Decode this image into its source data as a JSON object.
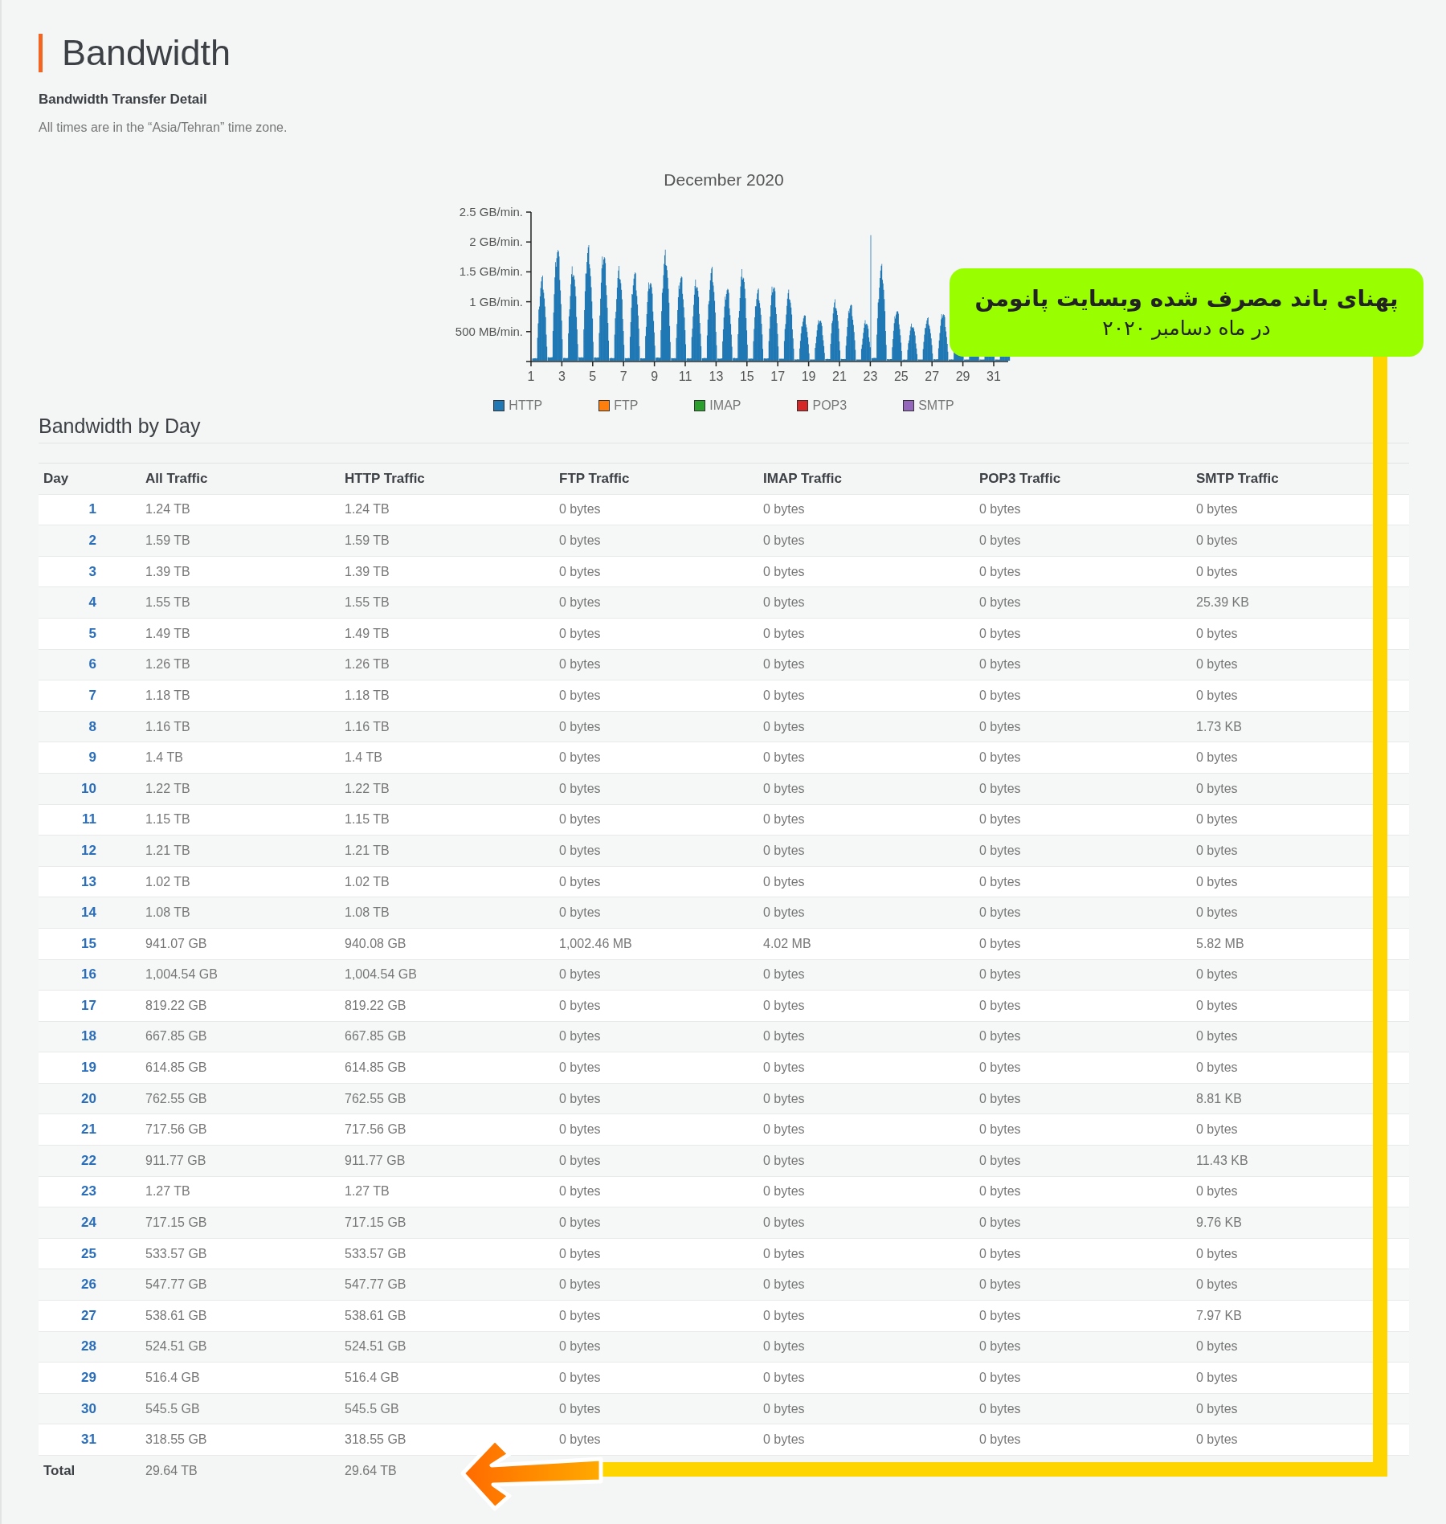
{
  "page": {
    "title": "Bandwidth",
    "subtitle": "Bandwidth Transfer Detail",
    "note": "All times are in the “Asia/Tehran” time zone."
  },
  "chart": {
    "title": "December 2020",
    "y_ticks": [
      "2.5 GB/min.",
      "2 GB/min.",
      "1.5 GB/min.",
      "1 GB/min.",
      "500 MB/min."
    ],
    "x_ticks": [
      "1",
      "3",
      "5",
      "7",
      "9",
      "11",
      "13",
      "15",
      "17",
      "19",
      "21",
      "23",
      "25",
      "27",
      "29",
      "31"
    ],
    "legend": [
      {
        "label": "HTTP",
        "color": "#1f77b4"
      },
      {
        "label": "FTP",
        "color": "#ff7f0e"
      },
      {
        "label": "IMAP",
        "color": "#2ca02c"
      },
      {
        "label": "POP3",
        "color": "#d62728"
      },
      {
        "label": "SMTP",
        "color": "#9467bd"
      }
    ]
  },
  "section_title": "Bandwidth by Day",
  "table": {
    "columns": [
      "Day",
      "All Traffic",
      "HTTP Traffic",
      "FTP Traffic",
      "IMAP Traffic",
      "POP3 Traffic",
      "SMTP Traffic"
    ],
    "rows": [
      [
        "1",
        "1.24 TB",
        "1.24 TB",
        "0 bytes",
        "0 bytes",
        "0 bytes",
        "0 bytes"
      ],
      [
        "2",
        "1.59 TB",
        "1.59 TB",
        "0 bytes",
        "0 bytes",
        "0 bytes",
        "0 bytes"
      ],
      [
        "3",
        "1.39 TB",
        "1.39 TB",
        "0 bytes",
        "0 bytes",
        "0 bytes",
        "0 bytes"
      ],
      [
        "4",
        "1.55 TB",
        "1.55 TB",
        "0 bytes",
        "0 bytes",
        "0 bytes",
        "25.39 KB"
      ],
      [
        "5",
        "1.49 TB",
        "1.49 TB",
        "0 bytes",
        "0 bytes",
        "0 bytes",
        "0 bytes"
      ],
      [
        "6",
        "1.26 TB",
        "1.26 TB",
        "0 bytes",
        "0 bytes",
        "0 bytes",
        "0 bytes"
      ],
      [
        "7",
        "1.18 TB",
        "1.18 TB",
        "0 bytes",
        "0 bytes",
        "0 bytes",
        "0 bytes"
      ],
      [
        "8",
        "1.16 TB",
        "1.16 TB",
        "0 bytes",
        "0 bytes",
        "0 bytes",
        "1.73 KB"
      ],
      [
        "9",
        "1.4 TB",
        "1.4 TB",
        "0 bytes",
        "0 bytes",
        "0 bytes",
        "0 bytes"
      ],
      [
        "10",
        "1.22 TB",
        "1.22 TB",
        "0 bytes",
        "0 bytes",
        "0 bytes",
        "0 bytes"
      ],
      [
        "11",
        "1.15 TB",
        "1.15 TB",
        "0 bytes",
        "0 bytes",
        "0 bytes",
        "0 bytes"
      ],
      [
        "12",
        "1.21 TB",
        "1.21 TB",
        "0 bytes",
        "0 bytes",
        "0 bytes",
        "0 bytes"
      ],
      [
        "13",
        "1.02 TB",
        "1.02 TB",
        "0 bytes",
        "0 bytes",
        "0 bytes",
        "0 bytes"
      ],
      [
        "14",
        "1.08 TB",
        "1.08 TB",
        "0 bytes",
        "0 bytes",
        "0 bytes",
        "0 bytes"
      ],
      [
        "15",
        "941.07 GB",
        "940.08 GB",
        "1,002.46 MB",
        "4.02 MB",
        "0 bytes",
        "5.82 MB"
      ],
      [
        "16",
        "1,004.54 GB",
        "1,004.54 GB",
        "0 bytes",
        "0 bytes",
        "0 bytes",
        "0 bytes"
      ],
      [
        "17",
        "819.22 GB",
        "819.22 GB",
        "0 bytes",
        "0 bytes",
        "0 bytes",
        "0 bytes"
      ],
      [
        "18",
        "667.85 GB",
        "667.85 GB",
        "0 bytes",
        "0 bytes",
        "0 bytes",
        "0 bytes"
      ],
      [
        "19",
        "614.85 GB",
        "614.85 GB",
        "0 bytes",
        "0 bytes",
        "0 bytes",
        "0 bytes"
      ],
      [
        "20",
        "762.55 GB",
        "762.55 GB",
        "0 bytes",
        "0 bytes",
        "0 bytes",
        "8.81 KB"
      ],
      [
        "21",
        "717.56 GB",
        "717.56 GB",
        "0 bytes",
        "0 bytes",
        "0 bytes",
        "0 bytes"
      ],
      [
        "22",
        "911.77 GB",
        "911.77 GB",
        "0 bytes",
        "0 bytes",
        "0 bytes",
        "11.43 KB"
      ],
      [
        "23",
        "1.27 TB",
        "1.27 TB",
        "0 bytes",
        "0 bytes",
        "0 bytes",
        "0 bytes"
      ],
      [
        "24",
        "717.15 GB",
        "717.15 GB",
        "0 bytes",
        "0 bytes",
        "0 bytes",
        "9.76 KB"
      ],
      [
        "25",
        "533.57 GB",
        "533.57 GB",
        "0 bytes",
        "0 bytes",
        "0 bytes",
        "0 bytes"
      ],
      [
        "26",
        "547.77 GB",
        "547.77 GB",
        "0 bytes",
        "0 bytes",
        "0 bytes",
        "0 bytes"
      ],
      [
        "27",
        "538.61 GB",
        "538.61 GB",
        "0 bytes",
        "0 bytes",
        "0 bytes",
        "7.97 KB"
      ],
      [
        "28",
        "524.51 GB",
        "524.51 GB",
        "0 bytes",
        "0 bytes",
        "0 bytes",
        "0 bytes"
      ],
      [
        "29",
        "516.4 GB",
        "516.4 GB",
        "0 bytes",
        "0 bytes",
        "0 bytes",
        "0 bytes"
      ],
      [
        "30",
        "545.5 GB",
        "545.5 GB",
        "0 bytes",
        "0 bytes",
        "0 bytes",
        "0 bytes"
      ],
      [
        "31",
        "318.55 GB",
        "318.55 GB",
        "0 bytes",
        "0 bytes",
        "0 bytes",
        "0 bytes"
      ]
    ],
    "total": {
      "label": "Total",
      "cells": [
        "29.64 TB",
        "29.64 TB"
      ]
    }
  },
  "annotation": {
    "title": "پهنای باند مصرف شده وبسایت پانومن",
    "subtitle": "در ماه دسامبر ۲۰۲۰"
  }
}
